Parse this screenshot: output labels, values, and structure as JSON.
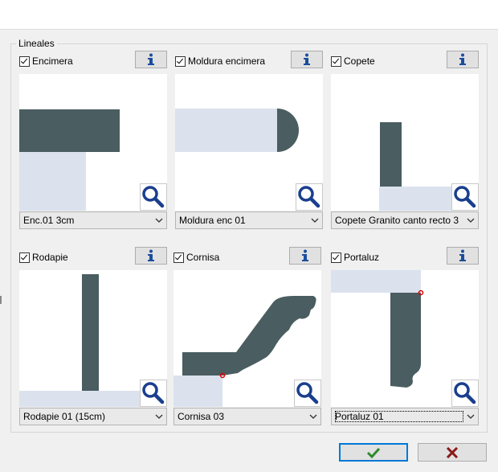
{
  "group": {
    "label": "Lineales"
  },
  "colors": {
    "profile": "#4a5d60",
    "background_piece": "#dbe2ee",
    "accent_red": "#e00000",
    "ok_green": "#2e8b2e",
    "cancel_red": "#8b1a1a"
  },
  "cells": [
    {
      "label": "Encimera",
      "checked": true,
      "selected": "Enc.01 3cm"
    },
    {
      "label": "Moldura encimera",
      "checked": true,
      "selected": "Moldura enc 01"
    },
    {
      "label": "Copete",
      "checked": true,
      "selected": "Copete Granito canto recto 3"
    },
    {
      "label": "Rodapie",
      "checked": true,
      "selected": "Rodapie 01 (15cm)"
    },
    {
      "label": "Cornisa",
      "checked": true,
      "selected": "Cornisa 03"
    },
    {
      "label": "Portaluz",
      "checked": true,
      "selected": "Portaluz 01"
    }
  ],
  "icons": {
    "info": "info-icon",
    "zoom": "magnifier-icon",
    "ok": "checkmark-icon",
    "cancel": "x-icon",
    "dropdown": "chevron-down-icon"
  }
}
